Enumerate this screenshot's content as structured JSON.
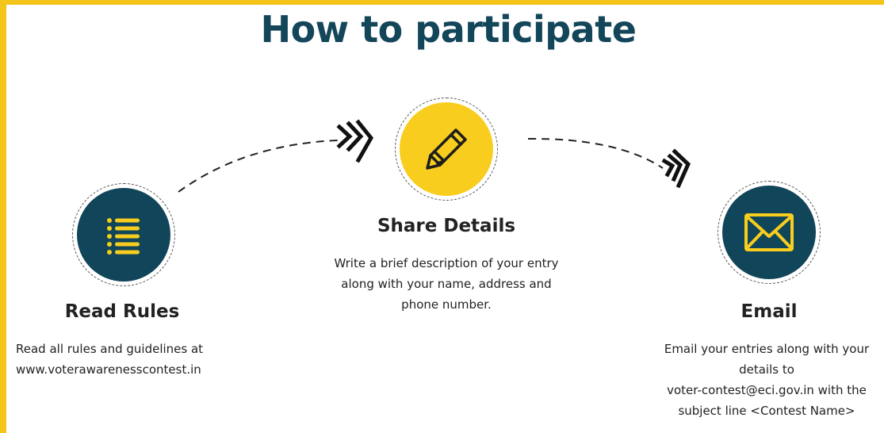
{
  "page": {
    "title": "How to participate"
  },
  "steps": [
    {
      "title": "Read Rules",
      "icon": "list-icon",
      "description_lines": [
        "Read all rules and guidelines at",
        "www.voterawarenesscontest.in"
      ]
    },
    {
      "title": "Share Details",
      "icon": "pencil-icon",
      "description_lines": [
        "Write a brief description of your entry",
        "along with your name, address and",
        "phone number."
      ]
    },
    {
      "title": "Email",
      "icon": "envelope-icon",
      "description_lines": [
        "Email your entries along with your",
        "details to",
        "voter-contest@eci.gov.in with the",
        "subject line <Contest Name>"
      ]
    }
  ],
  "colors": {
    "accent_yellow": "#f8cd1e",
    "dark_teal": "#11455a",
    "title_color": "#14465a",
    "frame": "#f3c41a"
  }
}
